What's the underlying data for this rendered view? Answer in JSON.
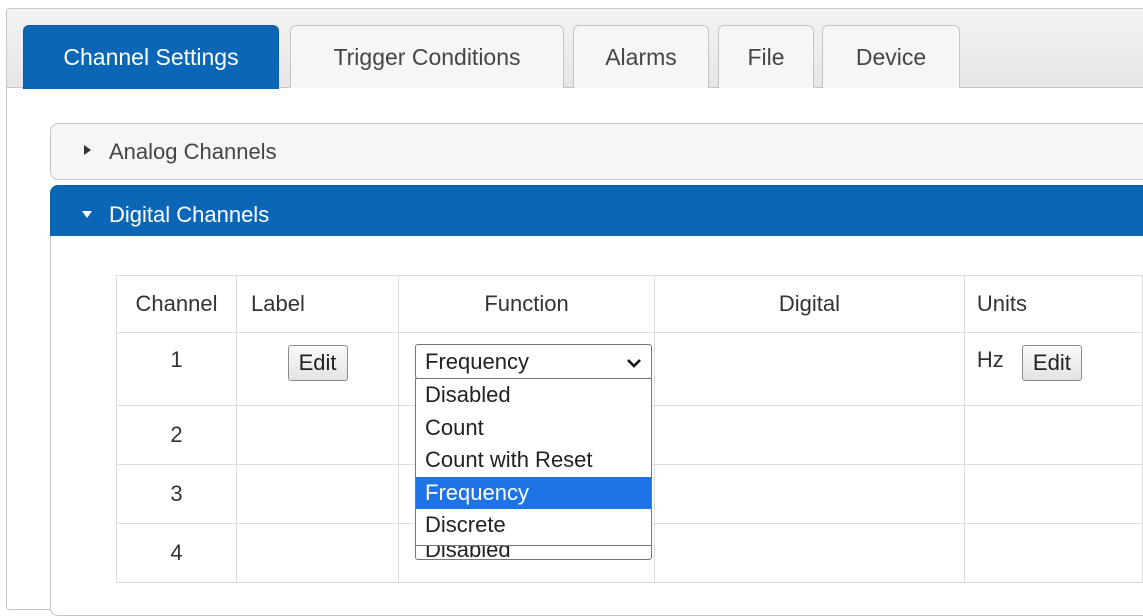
{
  "tabs": [
    "Channel Settings",
    "Trigger Conditions",
    "Alarms",
    "File",
    "Device"
  ],
  "panels": {
    "analog": {
      "title": "Analog Channels",
      "state": "collapsed"
    },
    "digital": {
      "title": "Digital Channels",
      "state": "expanded"
    }
  },
  "table": {
    "headers": {
      "channel": "Channel",
      "label": "Label",
      "function": "Function",
      "digital": "Digital",
      "units": "Units"
    },
    "rows": [
      {
        "channel": "1",
        "label_button": "Edit",
        "function": "Frequency",
        "units": "Hz",
        "units_button": "Edit"
      },
      {
        "channel": "2"
      },
      {
        "channel": "3"
      },
      {
        "channel": "4",
        "function": "Disabled"
      }
    ]
  },
  "function_dropdown": {
    "options": [
      "Disabled",
      "Count",
      "Count with Reset",
      "Frequency",
      "Discrete"
    ],
    "selected": "Frequency"
  },
  "colors": {
    "accent": "#0b67b6",
    "highlight": "#1e74e6"
  },
  "icons": {
    "collapsed_arrow": "triangle-right-icon",
    "expanded_arrow": "triangle-down-icon",
    "select_arrow": "chevron-down-icon"
  }
}
